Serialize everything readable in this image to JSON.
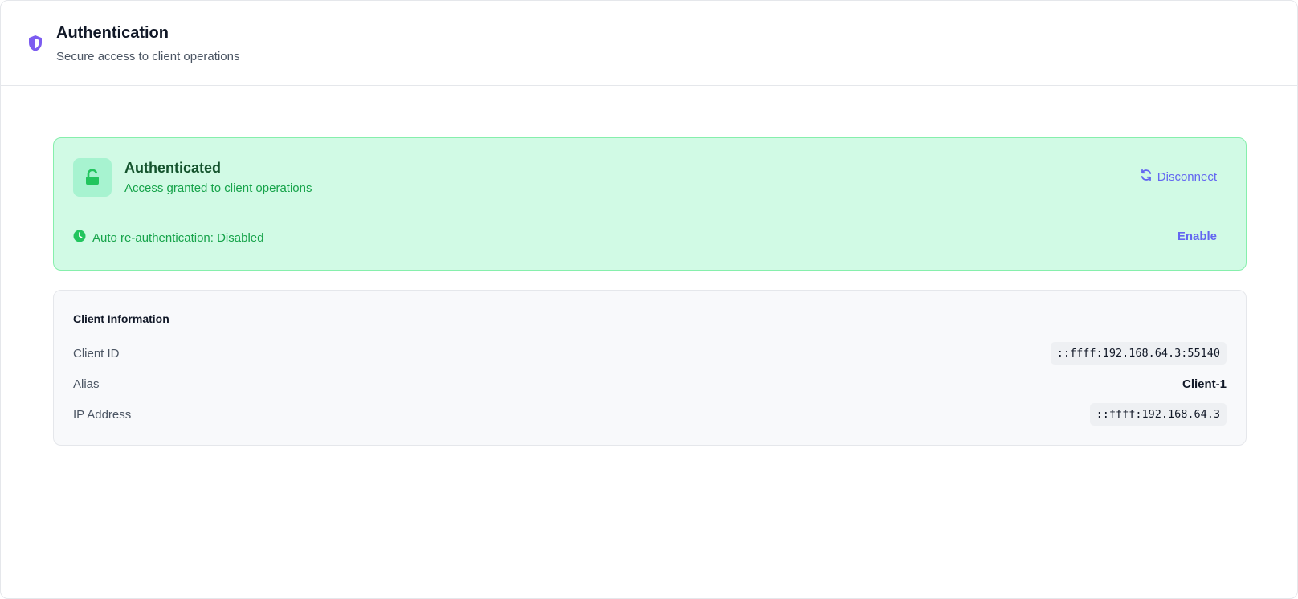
{
  "header": {
    "title": "Authentication",
    "subtitle": "Secure access to client operations",
    "icon": "shield-icon",
    "accent": "#7c5cf0"
  },
  "auth_status": {
    "title": "Authenticated",
    "subtitle": "Access granted to client operations",
    "icon": "unlock-icon",
    "disconnect_label": "Disconnect",
    "reauth_label": "Auto re-authentication: Disabled",
    "enable_label": "Enable",
    "colors": {
      "background": "#d1fae5",
      "border": "#86efac",
      "success": "#16a34a",
      "action": "#6366f1"
    }
  },
  "client_info": {
    "title": "Client Information",
    "rows": [
      {
        "label": "Client ID",
        "value": "::ffff:192.168.64.3:55140"
      },
      {
        "label": "Alias",
        "value": "Client-1"
      },
      {
        "label": "IP Address",
        "value": "::ffff:192.168.64.3"
      }
    ]
  }
}
